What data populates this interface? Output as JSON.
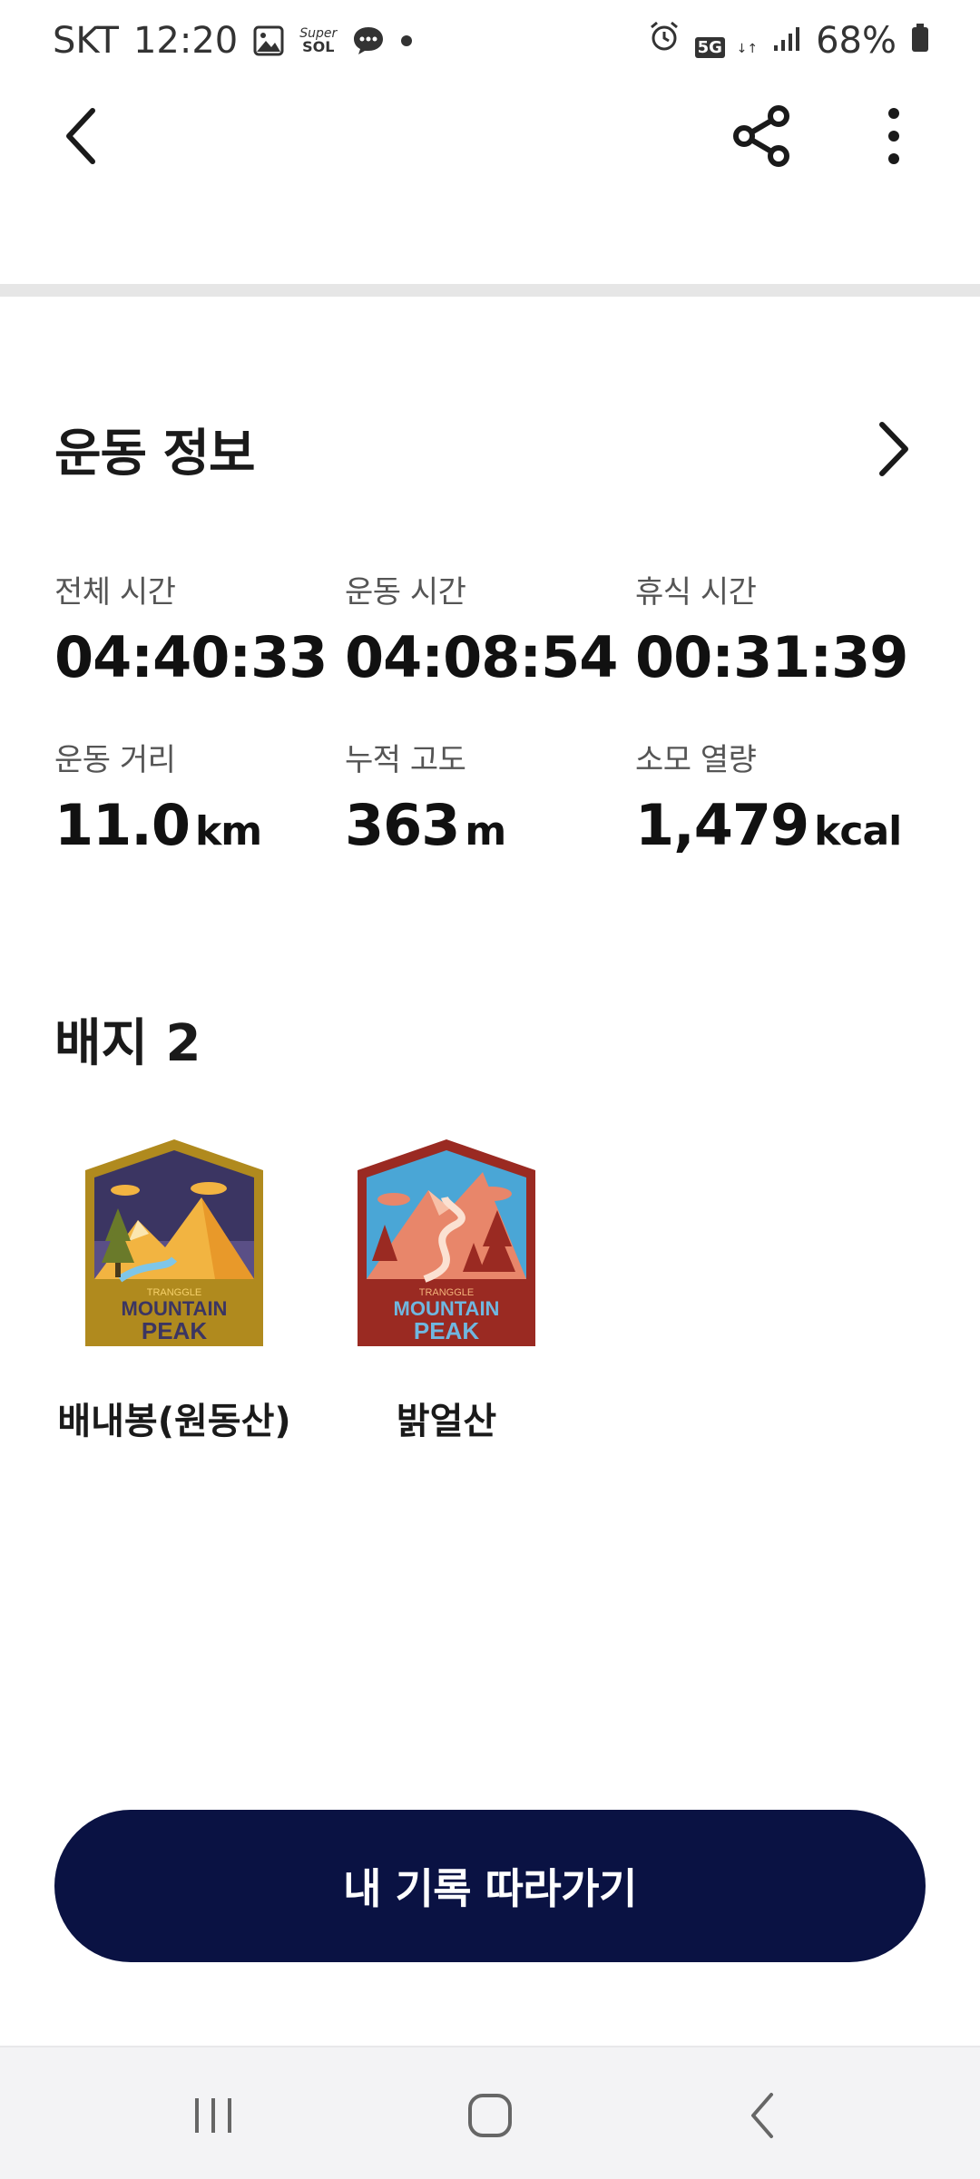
{
  "status_bar": {
    "carrier": "SKT",
    "time": "12:20",
    "notif_super_label": "Super",
    "notif_sol_label": "SOL",
    "network": "5G",
    "battery": "68%"
  },
  "workout": {
    "section_title": "운동 정보",
    "stats": [
      {
        "label": "전체 시간",
        "value": "04:40:33",
        "unit": ""
      },
      {
        "label": "운동 시간",
        "value": "04:08:54",
        "unit": ""
      },
      {
        "label": "휴식 시간",
        "value": "00:31:39",
        "unit": ""
      },
      {
        "label": "운동 거리",
        "value": "11.0",
        "unit": "km"
      },
      {
        "label": "누적 고도",
        "value": "363",
        "unit": "m"
      },
      {
        "label": "소모 열량",
        "value": "1,479",
        "unit": "kcal"
      }
    ]
  },
  "badges": {
    "title": "배지 2",
    "items": [
      {
        "name": "배내봉(원동산)",
        "brand": "TRANGGLE",
        "line1": "MOUNTAIN",
        "line2": "PEAK",
        "frame_color": "#b08a1e",
        "sky_color": "#3b3562"
      },
      {
        "name": "밝얼산",
        "brand": "TRANGGLE",
        "line1": "MOUNTAIN",
        "line2": "PEAK",
        "frame_color": "#9a2a22",
        "sky_color": "#4aa6d6"
      }
    ]
  },
  "cta_label": "내 기록 따라가기",
  "colors": {
    "cta_bg": "#0a1243",
    "divider": "#e6e6e6"
  }
}
